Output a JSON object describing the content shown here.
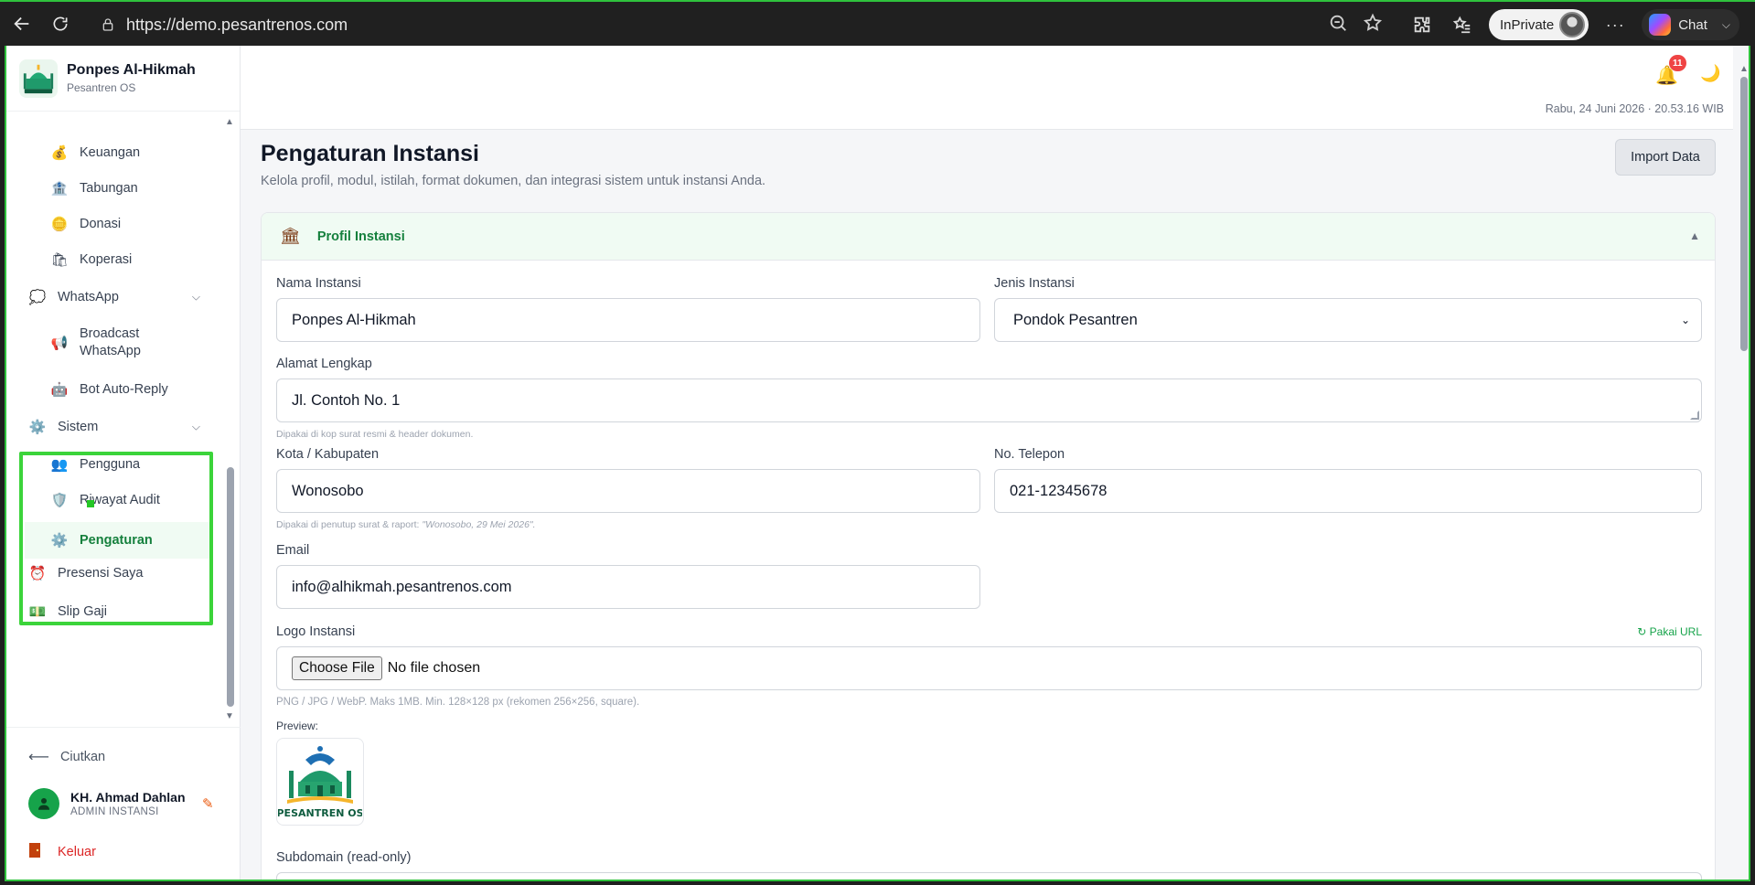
{
  "browser": {
    "url": "https://demo.pesantrenos.com",
    "inprivate_label": "InPrivate",
    "chat_label": "Chat",
    "more_label": "···"
  },
  "brand": {
    "name": "Ponpes Al-Hikmah",
    "subtitle": "Pesantren OS"
  },
  "sidebar": {
    "items": [
      {
        "label": "Keuangan",
        "icon": "money-bag-icon"
      },
      {
        "label": "Tabungan",
        "icon": "bank-icon"
      },
      {
        "label": "Donasi",
        "icon": "coins-icon"
      },
      {
        "label": "Koperasi",
        "icon": "shopping-bag-icon"
      },
      {
        "label": "WhatsApp",
        "icon": "chat-bubble-icon"
      },
      {
        "label": "Broadcast WhatsApp",
        "icon": "megaphone-icon"
      },
      {
        "label": "Bot Auto-Reply",
        "icon": "robot-icon"
      },
      {
        "label": "Sistem",
        "icon": "gear-icon"
      },
      {
        "label": "Pengguna",
        "icon": "users-icon"
      },
      {
        "label": "Riwayat Audit",
        "icon": "shield-icon"
      },
      {
        "label": "Pengaturan",
        "icon": "gear-icon"
      },
      {
        "label": "Presensi Saya",
        "icon": "alarm-clock-icon"
      },
      {
        "label": "Slip Gaji",
        "icon": "banknote-icon"
      }
    ],
    "collapse_label": "Ciutkan",
    "user_name": "KH. Ahmad Dahlan",
    "user_role": "ADMIN INSTANSI",
    "logout_label": "Keluar"
  },
  "topbar": {
    "notification_count": "11",
    "datetime": "Rabu, 24 Juni 2026 · 20.53.16 WIB"
  },
  "header": {
    "title": "Pengaturan Instansi",
    "description": "Kelola profil, modul, istilah, format dokumen, dan integrasi sistem untuk instansi Anda.",
    "import_label": "Import Data"
  },
  "profile": {
    "section_title": "Profil Instansi",
    "nama_label": "Nama Instansi",
    "nama_value": "Ponpes Al-Hikmah",
    "jenis_label": "Jenis Instansi",
    "jenis_value": "Pondok Pesantren",
    "alamat_label": "Alamat Lengkap",
    "alamat_value": "Jl. Contoh No. 1",
    "alamat_hint": "Dipakai di kop surat resmi & header dokumen.",
    "kota_label": "Kota / Kabupaten",
    "kota_value": "Wonosobo",
    "kota_hint_prefix": "Dipakai di penutup surat & raport:",
    "kota_hint_example": "\"Wonosobo, 29 Mei 2026\".",
    "telepon_label": "No. Telepon",
    "telepon_value": "021-12345678",
    "email_label": "Email",
    "email_value": "info@alhikmah.pesantrenos.com",
    "logo_label": "Logo Instansi",
    "pakai_url_label": "↻ Pakai URL",
    "file_button": "Choose File",
    "file_status": "No file chosen",
    "logo_hint": "PNG / JPG / WebP. Maks 1MB. Min. 128×128 px (rekomen 256×256, square).",
    "preview_label": "Preview:",
    "logo_text": "PESANTREN OS",
    "subdomain_label": "Subdomain (read-only)"
  },
  "colors": {
    "accent_green": "#15803d",
    "highlight_box": "#3bd43a",
    "danger": "#dc2626"
  }
}
